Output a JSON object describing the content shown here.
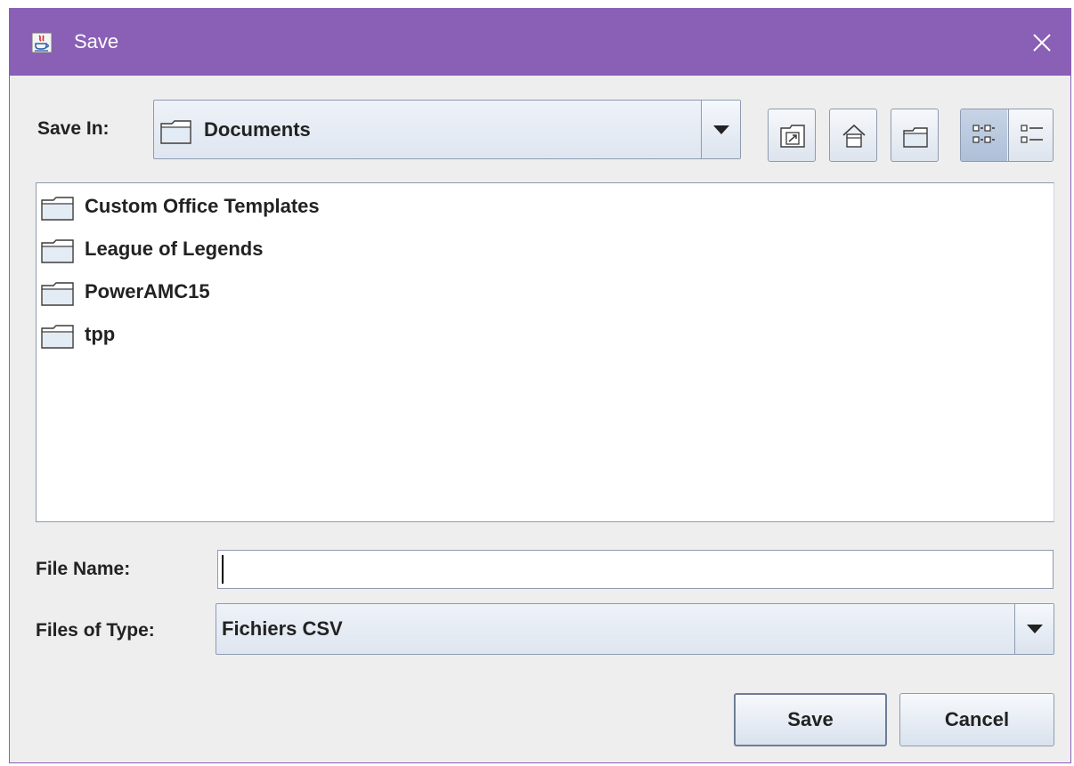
{
  "window": {
    "title": "Save",
    "colors": {
      "titlebar": "#8a5fb6",
      "body": "#eeeeee",
      "control": "#dfe6f1",
      "border": "#8e9bb0"
    }
  },
  "save_in": {
    "label": "Save In:",
    "selected": "Documents",
    "icon": "folder-icon"
  },
  "toolbar": {
    "buttons": [
      {
        "name": "up-one-level-button",
        "icon": "folder-up-icon"
      },
      {
        "name": "home-button",
        "icon": "home-icon"
      },
      {
        "name": "new-folder-button",
        "icon": "new-folder-icon"
      },
      {
        "name": "list-view-button",
        "icon": "list-view-icon",
        "selected": true
      },
      {
        "name": "details-view-button",
        "icon": "details-view-icon",
        "selected": false
      }
    ]
  },
  "files": [
    {
      "name": "Custom Office Templates",
      "icon": "folder-icon"
    },
    {
      "name": "League of Legends",
      "icon": "folder-icon"
    },
    {
      "name": "PowerAMC15",
      "icon": "folder-icon"
    },
    {
      "name": "tpp",
      "icon": "folder-icon"
    }
  ],
  "file_name": {
    "label": "File Name:",
    "value": ""
  },
  "file_type": {
    "label": "Files of Type:",
    "selected": "Fichiers CSV"
  },
  "actions": {
    "save_label": "Save",
    "cancel_label": "Cancel"
  }
}
